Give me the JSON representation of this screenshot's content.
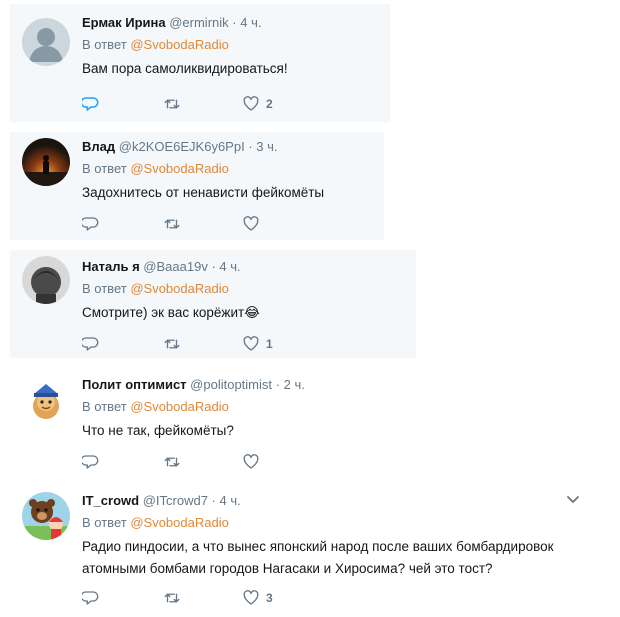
{
  "reply_prefix": "В ответ",
  "tweets": [
    {
      "name": "Ермак Ирина",
      "handle": "@ermirnik",
      "time": "4 ч.",
      "reply_to": "@SvobodaRadio",
      "text": "Вам пора самоликвидироваться!",
      "likes": "2",
      "reply_active": true
    },
    {
      "name": "Влад",
      "handle": "@k2KOE6EJK6y6PpI",
      "time": "3 ч.",
      "reply_to": "@SvobodaRadio",
      "text": "Задохнитесь от ненависти фейкомёты",
      "likes": ""
    },
    {
      "name": "Наталь я",
      "handle": "@Baaa19v",
      "time": "4 ч.",
      "reply_to": "@SvobodaRadio",
      "text": "Смотрите) эк вас корёжит😂",
      "likes": "1"
    },
    {
      "name": "Полит оптимист",
      "handle": "@politoptimist",
      "time": "2 ч.",
      "reply_to": "@SvobodaRadio",
      "text": "Что не так, фейкомёты?",
      "likes": ""
    },
    {
      "name": "IT_crowd",
      "handle": "@ITcrowd7",
      "time": "4 ч.",
      "reply_to": "@SvobodaRadio",
      "text": "Радио пиндосии, а что вынес японский народ после ваших бомбардировок атомными бомбами городов Нагасаки и Хиросима? чей это тост?",
      "likes": "3"
    }
  ],
  "icons": {
    "reply": "reply-icon",
    "retweet": "retweet-icon",
    "like": "heart-icon",
    "menu": "chevron-down-icon"
  },
  "colors": {
    "name": "#14171a",
    "secondary": "#657786",
    "mention": "#e0883a",
    "active": "#1da1f2",
    "highlight_bg": "#f5f8fa"
  }
}
